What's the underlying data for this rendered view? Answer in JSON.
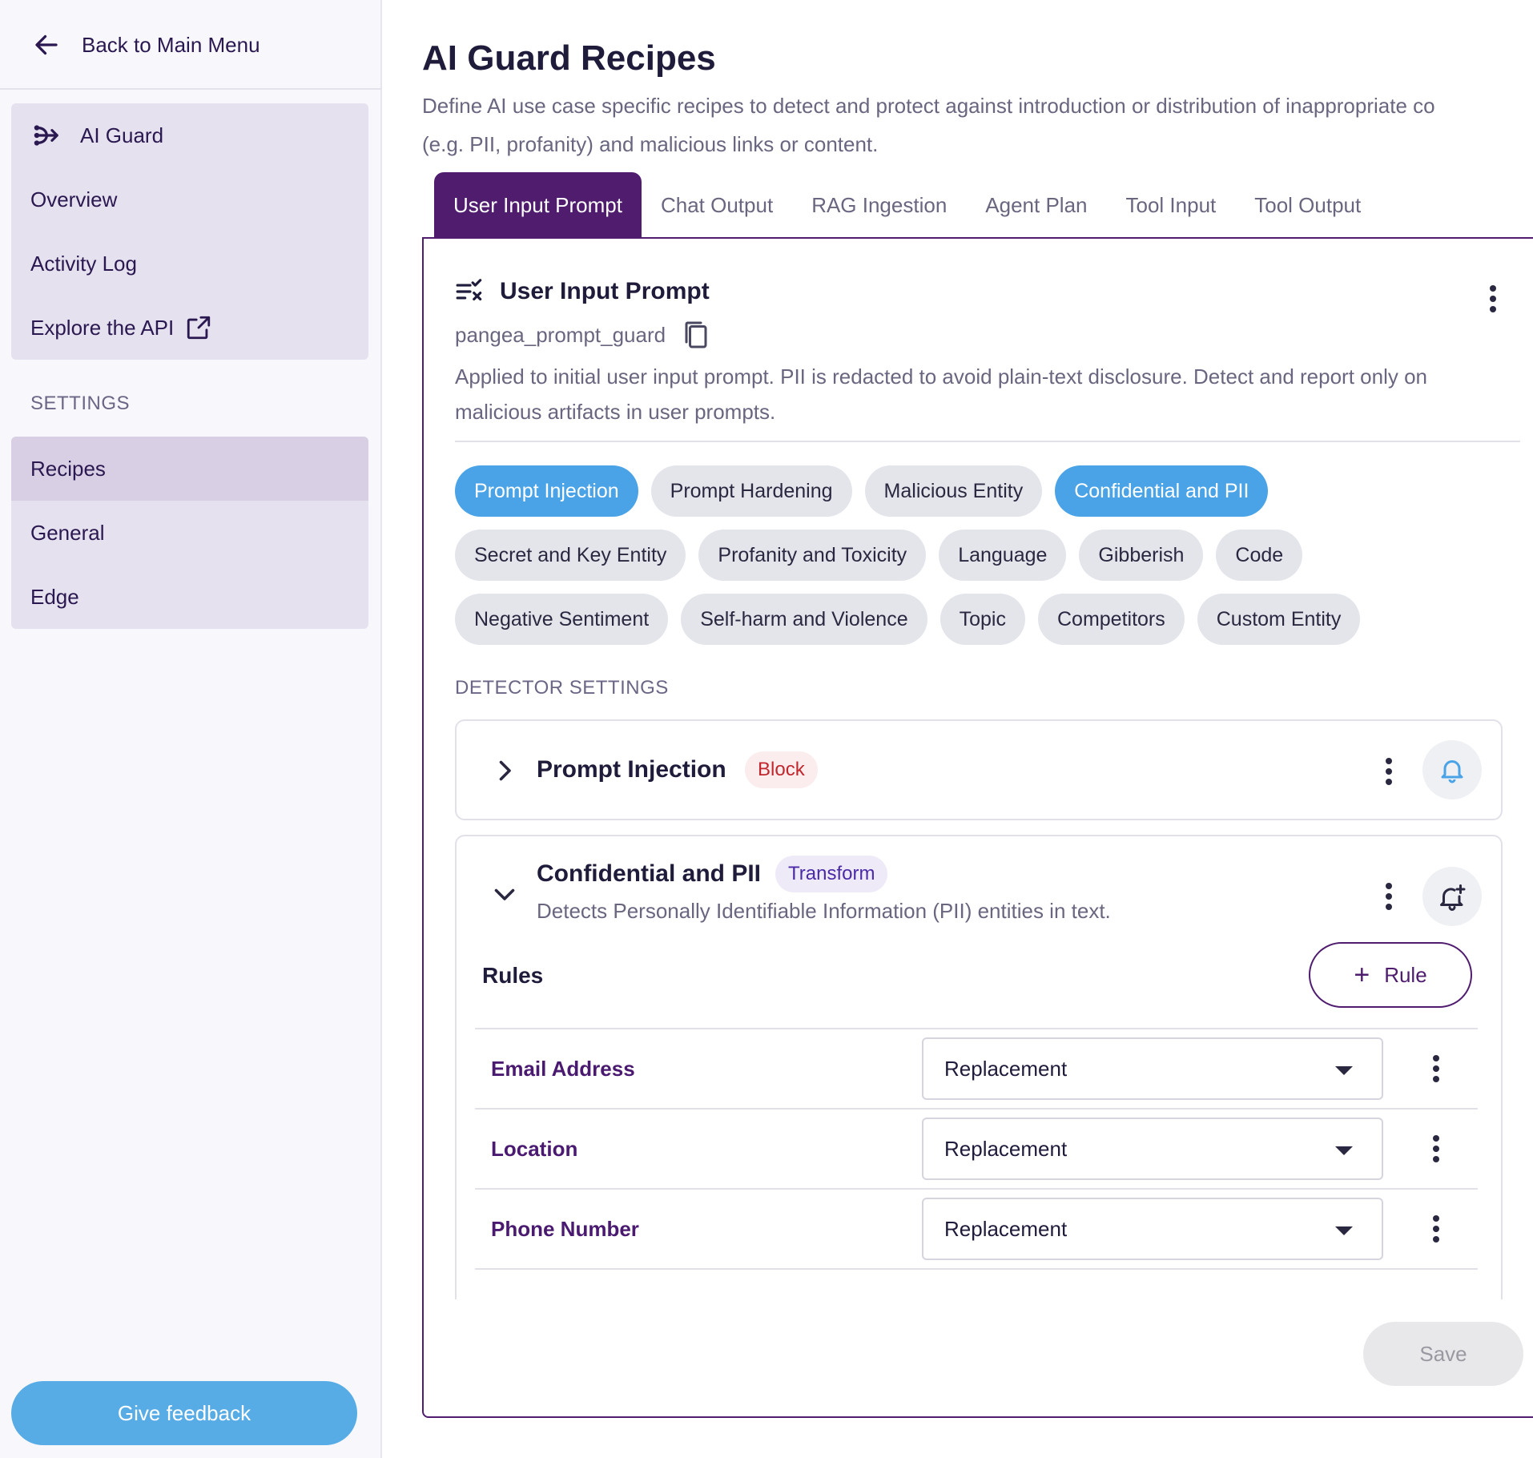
{
  "sidebar": {
    "back_label": "Back to Main Menu",
    "service_name": "AI Guard",
    "nav_items": [
      "Overview",
      "Activity Log",
      "Explore the API"
    ],
    "settings_label": "SETTINGS",
    "settings_items": [
      "Recipes",
      "General",
      "Edge"
    ],
    "active_item": "Recipes",
    "feedback_label": "Give feedback"
  },
  "page": {
    "title": "AI Guard Recipes",
    "subtitle_line1": "Define AI use case specific recipes to detect and protect against introduction or distribution of inappropriate co",
    "subtitle_line2": "(e.g. PII, profanity) and malicious links or content."
  },
  "tabs": [
    "User Input Prompt",
    "Chat Output",
    "RAG Ingestion",
    "Agent Plan",
    "Tool Input",
    "Tool Output"
  ],
  "active_tab": "User Input Prompt",
  "recipe": {
    "name": "User Input Prompt",
    "key": "pangea_prompt_guard",
    "description": "Applied to initial user input prompt. PII is redacted to avoid plain-text disclosure. Detect and report only on malicious artifacts in user prompts.",
    "detectors": [
      [
        {
          "label": "Prompt Injection",
          "enabled": true
        },
        {
          "label": "Prompt Hardening",
          "enabled": false
        },
        {
          "label": "Malicious Entity",
          "enabled": false
        },
        {
          "label": "Confidential and PII",
          "enabled": true
        }
      ],
      [
        {
          "label": "Secret and Key Entity",
          "enabled": false
        },
        {
          "label": "Profanity and Toxicity",
          "enabled": false
        },
        {
          "label": "Language",
          "enabled": false
        },
        {
          "label": "Gibberish",
          "enabled": false
        },
        {
          "label": "Code",
          "enabled": false
        }
      ],
      [
        {
          "label": "Negative Sentiment",
          "enabled": false
        },
        {
          "label": "Self-harm and Violence",
          "enabled": false
        },
        {
          "label": "Topic",
          "enabled": false
        },
        {
          "label": "Competitors",
          "enabled": false
        },
        {
          "label": "Custom Entity",
          "enabled": false
        }
      ]
    ],
    "detector_settings_label": "DETECTOR SETTINGS",
    "prompt_injection": {
      "title": "Prompt Injection",
      "action": "Block"
    },
    "pii": {
      "title": "Confidential and PII",
      "action": "Transform",
      "description": "Detects Personally Identifiable Information (PII) entities in text.",
      "rules_label": "Rules",
      "add_rule_label": "Rule",
      "rules": [
        {
          "name": "Email Address",
          "method": "Replacement"
        },
        {
          "name": "Location",
          "method": "Replacement"
        },
        {
          "name": "Phone Number",
          "method": "Replacement"
        }
      ]
    }
  },
  "save_label": "Save",
  "colors": {
    "brand": "#4f1c6e",
    "chip_on": "#4aa3e6",
    "feedback": "#57ace6",
    "block": "#c1272d",
    "transform": "#4a2aa6"
  }
}
